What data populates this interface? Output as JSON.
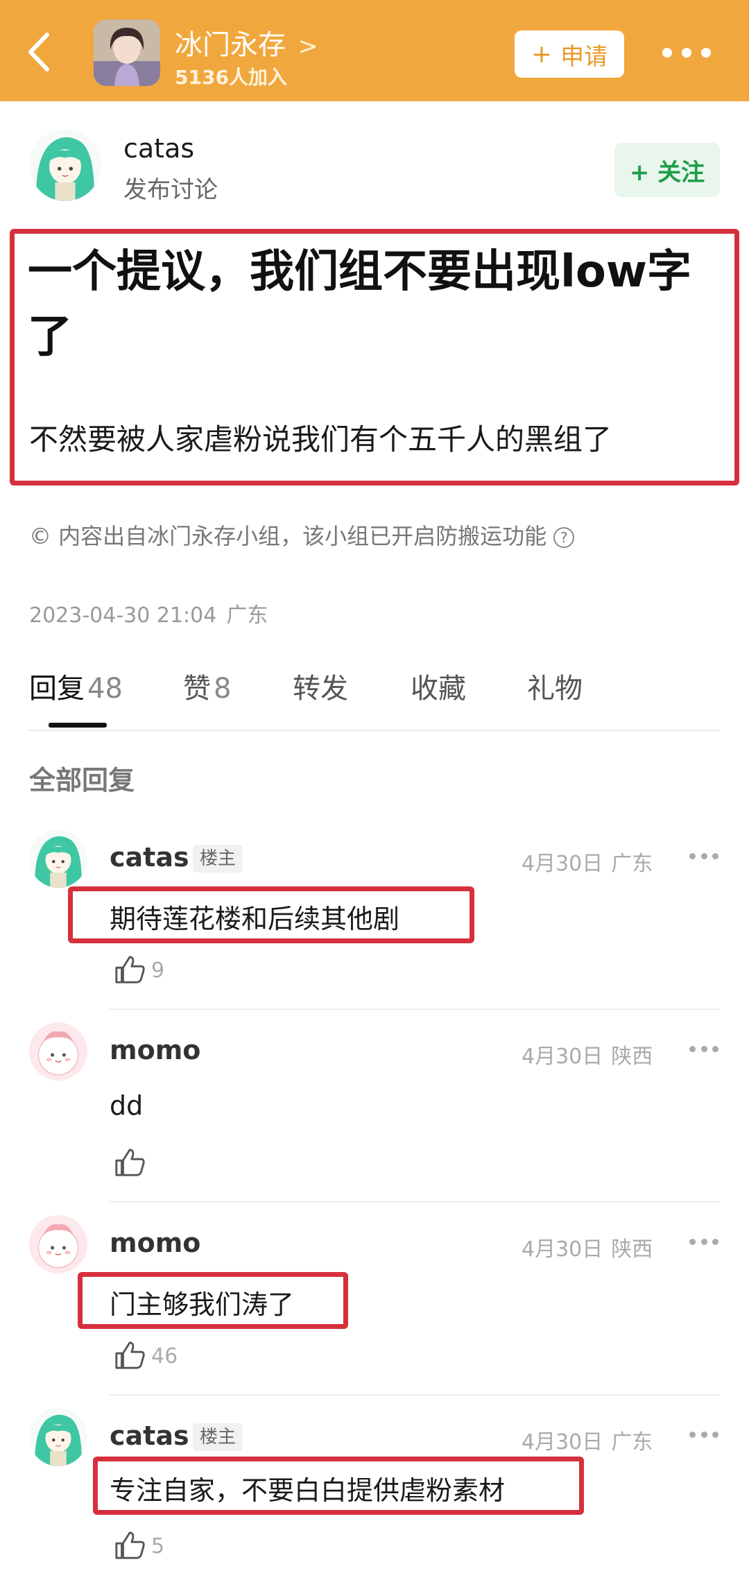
{
  "header": {
    "group_name": "冰门永存",
    "group_chevron": ">",
    "member_count": "5136人加入",
    "apply_plus": "+",
    "apply_label": "申请"
  },
  "author": {
    "name": "catas",
    "subtitle": "发布讨论",
    "follow_label": "+ 关注"
  },
  "post": {
    "title": "一个提议，我们组不要出现low字了",
    "body": "不然要被人家虐粉说我们有个五千人的黑组了",
    "copyright_symbol": "©",
    "copyright_text": "内容出自冰门永存小组，该小组已开启防搬运功能",
    "copyright_help": "?",
    "date": "2023-04-30 21:04",
    "location": "广东"
  },
  "tabs": [
    {
      "label": "回复",
      "count": "48"
    },
    {
      "label": "赞",
      "count": "8"
    },
    {
      "label": "转发",
      "count": ""
    },
    {
      "label": "收藏",
      "count": ""
    },
    {
      "label": "礼物",
      "count": ""
    }
  ],
  "section_title": "全部回复",
  "replies": [
    {
      "name": "catas",
      "badge": "楼主",
      "date": "4月30日",
      "location": "广东",
      "text": "期待莲花楼和后续其他剧",
      "likes": "9"
    },
    {
      "name": "momo",
      "badge": "",
      "date": "4月30日",
      "location": "陕西",
      "text": "dd",
      "likes": ""
    },
    {
      "name": "momo",
      "badge": "",
      "date": "4月30日",
      "location": "陕西",
      "text": "门主够我们涛了",
      "likes": "46"
    },
    {
      "name": "catas",
      "badge": "楼主",
      "date": "4月30日",
      "location": "广东",
      "text": "专注自家，不要白白提供虐粉素材",
      "likes": "5"
    }
  ],
  "colors": {
    "header_bg": "#f0a83e",
    "highlight_red": "#d6303c",
    "follow_green": "#1f9e4a"
  },
  "icons": {
    "back": "chevron-left-icon",
    "more": "more-dots-icon",
    "like": "thumbs-up-icon"
  }
}
